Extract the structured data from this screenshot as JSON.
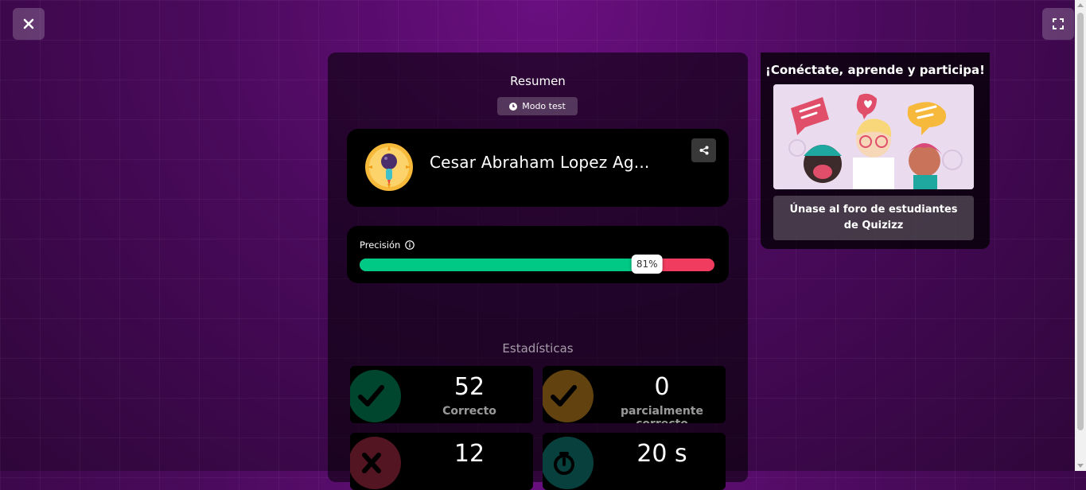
{
  "top_controls": {
    "close_icon": "close-icon",
    "fullscreen_icon": "fullscreen-icon"
  },
  "summary": {
    "title": "Resumen",
    "mode_label": "Modo test",
    "user_name": "Cesar Abraham Lopez Ag...",
    "accuracy_label": "Precisión",
    "accuracy_value": 81,
    "accuracy_text": "81%",
    "colors": {
      "correct": "#00c985",
      "incorrect": "#ef3c5f"
    }
  },
  "stats": {
    "title": "Estadísticas",
    "items": [
      {
        "value": "52",
        "label": "Correcto",
        "color": "#00c985",
        "icon": "check-icon"
      },
      {
        "value": "0",
        "label": "parcialmente correcto",
        "color": "#f5a524",
        "icon": "check-icon"
      },
      {
        "value": "12",
        "label": "",
        "color": "#ef3c5f",
        "icon": "x-icon"
      },
      {
        "value": "20 s",
        "label": "",
        "color": "#18b8b0",
        "icon": "timer-icon"
      }
    ]
  },
  "side": {
    "title": "¡Conéctate, aprende y participa!",
    "button_label": "Únase al foro de estudiantes de Quizizz"
  }
}
